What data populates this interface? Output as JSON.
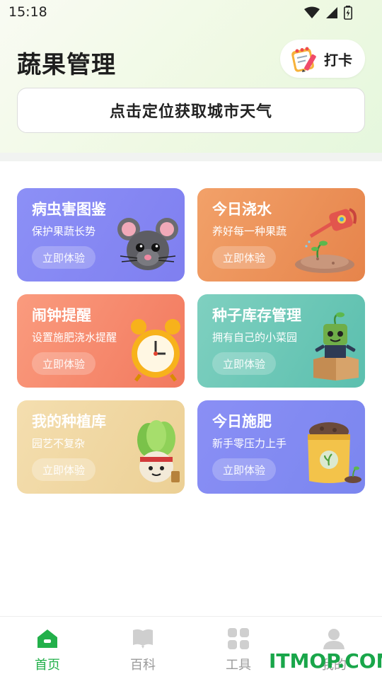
{
  "status_bar": {
    "time": "15:18"
  },
  "header": {
    "title": "蔬果管理",
    "checkin_label": "打卡"
  },
  "weather": {
    "prompt": "点击定位获取城市天气"
  },
  "cards": [
    {
      "title": "病虫害图鉴",
      "subtitle": "保护果蔬长势",
      "button": "立即体验",
      "icon": "mouse-icon"
    },
    {
      "title": "今日浇水",
      "subtitle": "养好每一种果蔬",
      "button": "立即体验",
      "icon": "watering-can-icon"
    },
    {
      "title": "闹钟提醒",
      "subtitle": "设置施肥浇水提醒",
      "button": "立即体验",
      "icon": "alarm-clock-icon"
    },
    {
      "title": "种子库存管理",
      "subtitle": "拥有自己的小菜园",
      "button": "立即体验",
      "icon": "seed-box-icon"
    },
    {
      "title": "我的种植库",
      "subtitle": "园艺不复杂",
      "button": "立即体验",
      "icon": "vegetable-icon"
    },
    {
      "title": "今日施肥",
      "subtitle": "新手零压力上手",
      "button": "立即体验",
      "icon": "fertilizer-bag-icon"
    }
  ],
  "bottom_nav": [
    {
      "label": "首页",
      "icon": "home-icon",
      "active": true
    },
    {
      "label": "百科",
      "icon": "book-icon",
      "active": false
    },
    {
      "label": "工具",
      "icon": "grid-icon",
      "active": false
    },
    {
      "label": "我的",
      "icon": "user-icon",
      "active": false
    }
  ],
  "watermark": "ITMOP.COM",
  "colors": {
    "accent": "#22b04a",
    "nav_inactive": "#9a9a9a"
  }
}
